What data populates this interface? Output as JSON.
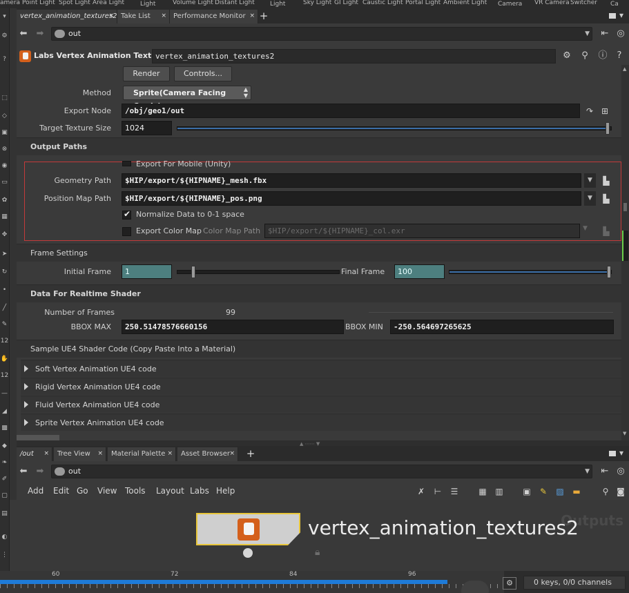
{
  "shelf": {
    "labels": [
      "amera",
      "Point Light",
      "Spot Light",
      "Area Light",
      "Light",
      "Volume Light",
      "Distant Light",
      "Light",
      "Sky Light",
      "GI Light",
      "Caustic Light",
      "Portal Light",
      "Ambient Light",
      "Camera",
      "VR Camera",
      "Switcher",
      "Ca"
    ]
  },
  "top_tabs": {
    "tab1": "vertex_animation_textures2",
    "tab2": "Take List",
    "tab3": "Performance Monitor",
    "close": "×",
    "plus": "+"
  },
  "top_path": {
    "value": "out"
  },
  "op_header": {
    "type_label": "Labs Vertex Animation Textures",
    "node_name": "vertex_animation_textures2",
    "icons": [
      "gear-icon",
      "search-icon",
      "info-icon",
      "help-icon"
    ]
  },
  "params": {
    "render_label": "Render",
    "controls_label": "Controls...",
    "method_label": "Method",
    "method_value": "Sprite(Camera Facing Cards)",
    "export_node_label": "Export Node",
    "export_node_value": "/obj/geo1/out",
    "target_texture_label": "Target Texture Size",
    "target_texture_value": "1024",
    "target_texture_fraction": 1.0,
    "output_paths_title": "Output Paths",
    "export_mobile_label": "Export For Mobile (Unity)",
    "geometry_path_label": "Geometry Path",
    "geometry_path_value": "$HIP/export/${HIPNAME}_mesh.fbx",
    "position_map_label": "Position Map Path",
    "position_map_value": "$HIP/export/${HIPNAME}_pos.png",
    "normalize_label": "Normalize Data to 0-1 space",
    "export_color_label": "Export Color Map",
    "color_map_label": "Color Map Path",
    "color_map_value": "$HIP/export/${HIPNAME}_col.exr",
    "frame_settings_title": "Frame Settings",
    "initial_frame_label": "Initial Frame",
    "initial_frame_value": "1",
    "final_frame_label": "Final Frame",
    "final_frame_value": "100",
    "realtime_title": "Data For Realtime Shader",
    "num_frames_label": "Number of Frames",
    "num_frames_value": "99",
    "bbox_max_label": "BBOX MAX",
    "bbox_max_value": "250.51478576660156",
    "bbox_min_label": "BBOX MIN",
    "bbox_min_value": "-250.564697265625",
    "sample_code_title": "Sample UE4 Shader Code (Copy Paste Into a Material)",
    "fold_rows": [
      "Soft Vertex Animation UE4 code",
      "Rigid Vertex Animation UE4 code",
      "Fluid Vertex Animation UE4 code",
      "Sprite Vertex Animation UE4 code"
    ]
  },
  "bottom_tabs": {
    "tab1": "/out",
    "tab2": "Tree View",
    "tab3": "Material Palette",
    "tab4": "Asset Browser",
    "close": "×",
    "plus": "+"
  },
  "bottom_path": {
    "value": "out"
  },
  "menubar": {
    "items": [
      "Add",
      "Edit",
      "Go",
      "View",
      "Tools",
      "Layout",
      "Labs",
      "Help"
    ]
  },
  "network": {
    "node_name": "vertex_animation_textures2",
    "watermark": "Outputs"
  },
  "timeline": {
    "ticks": [
      "60",
      "72",
      "84",
      "96"
    ],
    "keys_status": "0 keys, 0/0 channels"
  },
  "colors": {
    "accent_blue": "#1e7bd8",
    "node_orange": "#d4601c",
    "selection_red": "#c43a3a",
    "node_outline": "#e8c63a"
  }
}
